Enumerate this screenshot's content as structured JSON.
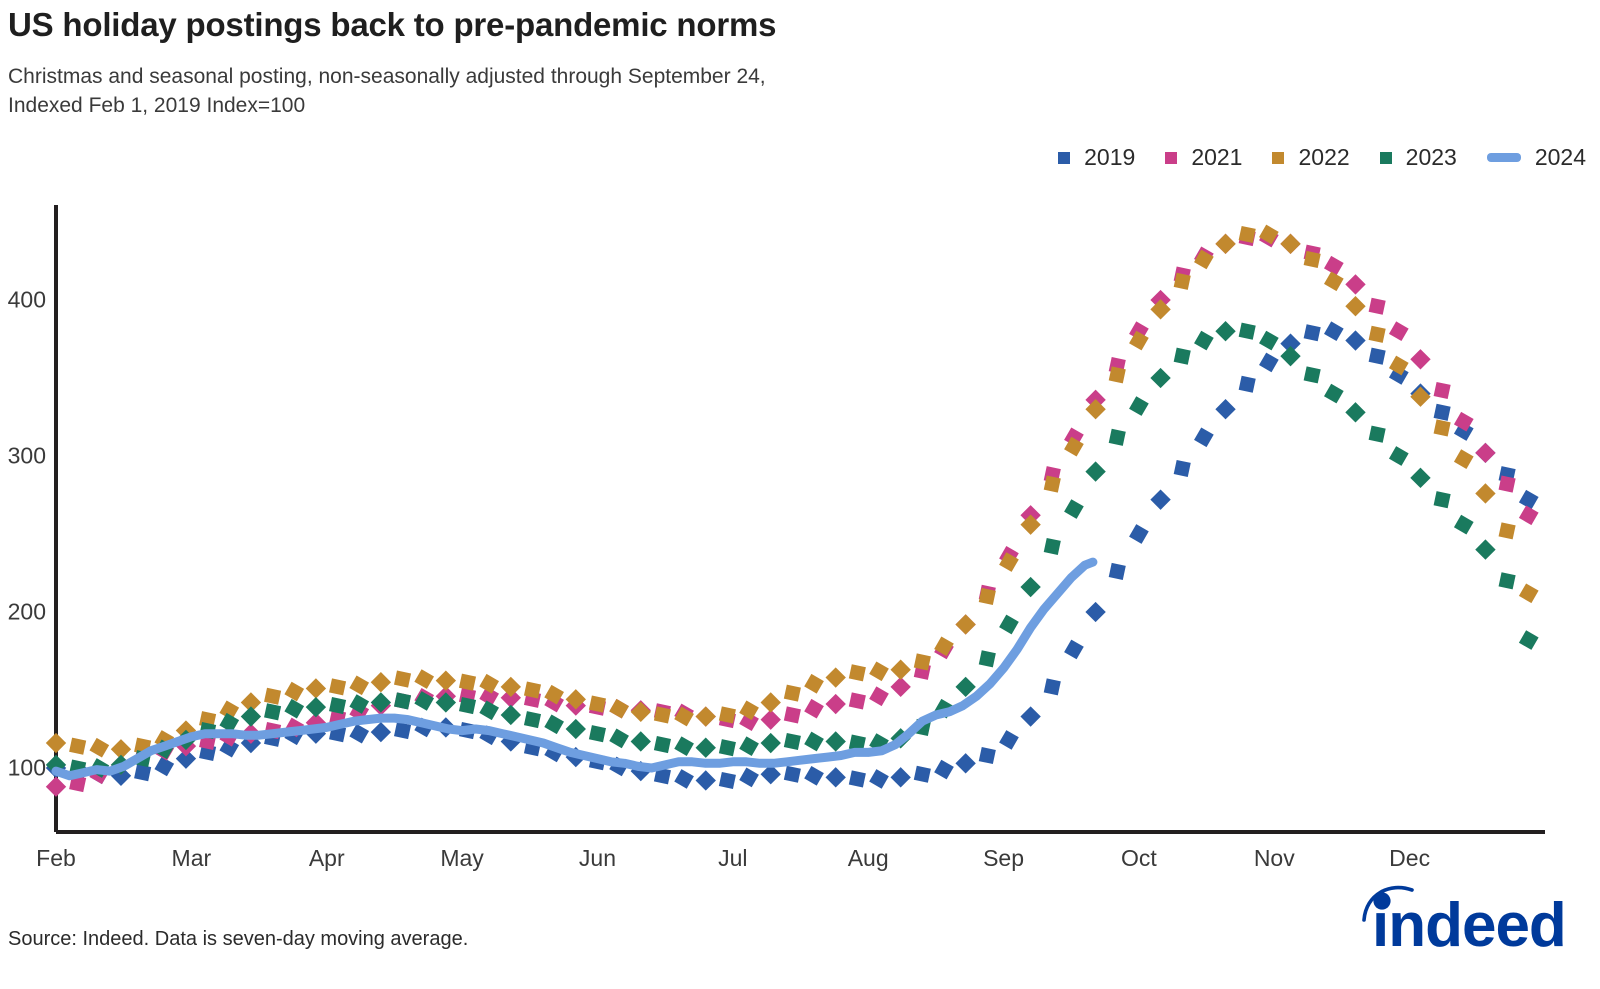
{
  "header": {
    "title": "US holiday postings back to pre-pandemic norms",
    "subtitle": "Christmas and seasonal posting, non-seasonally adjusted through September 24,\nIndexed Feb 1, 2019 Index=100"
  },
  "footer": {
    "source": "Source: Indeed. Data is seven-day moving average.",
    "logo_name": "indeed",
    "logo_color": "#003a9b"
  },
  "chart_data": {
    "type": "line",
    "title": "US holiday postings back to pre-pandemic norms",
    "subtitle": "Christmas and seasonal posting, non-seasonally adjusted through September 24, Indexed Feb 1, 2019 Index=100",
    "xlabel": "",
    "ylabel": "",
    "ylim": [
      75,
      455
    ],
    "xlim": [
      0,
      11
    ],
    "yticks": [
      100,
      200,
      300,
      400
    ],
    "ytick_labels": [
      "100",
      "200",
      "300",
      "400"
    ],
    "xticks": [
      0,
      1,
      2,
      3,
      4,
      5,
      6,
      7,
      8,
      9,
      10
    ],
    "xtick_labels": [
      "Feb",
      "Mar",
      "Apr",
      "May",
      "Jun",
      "Jul",
      "Aug",
      "Sep",
      "Oct",
      "Nov",
      "Dec"
    ],
    "grid": false,
    "legend_position": "top-right",
    "marker_style": "diamond",
    "series": [
      {
        "name": "2019",
        "color": "#2b5ca8",
        "style": "markers",
        "x": [
          0.0,
          0.16,
          0.32,
          0.48,
          0.64,
          0.8,
          0.96,
          1.12,
          1.28,
          1.44,
          1.6,
          1.76,
          1.92,
          2.08,
          2.24,
          2.4,
          2.56,
          2.72,
          2.88,
          3.04,
          3.2,
          3.36,
          3.52,
          3.68,
          3.84,
          4.0,
          4.16,
          4.32,
          4.48,
          4.64,
          4.8,
          4.96,
          5.12,
          5.28,
          5.44,
          5.6,
          5.76,
          5.92,
          6.08,
          6.24,
          6.4,
          6.56,
          6.72,
          6.88,
          7.04,
          7.2,
          7.36,
          7.52,
          7.68,
          7.84,
          8.0,
          8.16,
          8.32,
          8.48,
          8.64,
          8.8,
          8.96,
          9.12,
          9.28,
          9.44,
          9.6,
          9.76,
          9.92,
          10.08,
          10.24,
          10.4,
          10.56,
          10.72,
          10.88
        ],
        "y": [
          100,
          97,
          96,
          95,
          97,
          101,
          106,
          110,
          113,
          116,
          119,
          121,
          122,
          122,
          122,
          123,
          124,
          126,
          126,
          124,
          121,
          117,
          113,
          110,
          107,
          104,
          101,
          98,
          95,
          93,
          92,
          92,
          94,
          96,
          96,
          95,
          94,
          93,
          93,
          94,
          96,
          99,
          103,
          108,
          118,
          133,
          152,
          176,
          200,
          226,
          250,
          272,
          292,
          312,
          330,
          346,
          360,
          372,
          379,
          380,
          374,
          364,
          352,
          340,
          328,
          316,
          302,
          288,
          272
        ]
      },
      {
        "name": "2021",
        "color": "#ca3e89",
        "style": "markers",
        "x": [
          0.0,
          0.16,
          0.32,
          0.48,
          0.64,
          0.8,
          0.96,
          1.12,
          1.28,
          1.44,
          1.6,
          1.76,
          1.92,
          2.08,
          2.24,
          2.4,
          2.56,
          2.72,
          2.88,
          3.04,
          3.2,
          3.36,
          3.52,
          3.68,
          3.84,
          4.0,
          4.16,
          4.32,
          4.48,
          4.64,
          4.8,
          4.96,
          5.12,
          5.28,
          5.44,
          5.6,
          5.76,
          5.92,
          6.08,
          6.24,
          6.4,
          6.56,
          6.72,
          6.88,
          7.04,
          7.2,
          7.36,
          7.52,
          7.68,
          7.84,
          8.0,
          8.16,
          8.32,
          8.48,
          8.64,
          8.8,
          8.96,
          9.12,
          9.28,
          9.44,
          9.6,
          9.76,
          9.92,
          10.08,
          10.24,
          10.4,
          10.56,
          10.72,
          10.88
        ],
        "y": [
          88,
          90,
          96,
          102,
          107,
          111,
          114,
          117,
          120,
          122,
          124,
          126,
          129,
          132,
          136,
          140,
          143,
          145,
          146,
          146,
          146,
          145,
          144,
          142,
          140,
          139,
          138,
          137,
          136,
          135,
          133,
          131,
          130,
          131,
          134,
          138,
          141,
          143,
          146,
          152,
          162,
          176,
          192,
          212,
          236,
          262,
          288,
          312,
          336,
          358,
          380,
          400,
          416,
          428,
          436,
          440,
          440,
          436,
          430,
          422,
          410,
          396,
          380,
          362,
          342,
          322,
          302,
          282,
          262
        ]
      },
      {
        "name": "2022",
        "color": "#c2892e",
        "style": "markers",
        "x": [
          0.0,
          0.16,
          0.32,
          0.48,
          0.64,
          0.8,
          0.96,
          1.12,
          1.28,
          1.44,
          1.6,
          1.76,
          1.92,
          2.08,
          2.24,
          2.4,
          2.56,
          2.72,
          2.88,
          3.04,
          3.2,
          3.36,
          3.52,
          3.68,
          3.84,
          4.0,
          4.16,
          4.32,
          4.48,
          4.64,
          4.8,
          4.96,
          5.12,
          5.28,
          5.44,
          5.6,
          5.76,
          5.92,
          6.08,
          6.24,
          6.4,
          6.56,
          6.72,
          6.88,
          7.04,
          7.2,
          7.36,
          7.52,
          7.68,
          7.84,
          8.0,
          8.16,
          8.32,
          8.48,
          8.64,
          8.8,
          8.96,
          9.12,
          9.28,
          9.44,
          9.6,
          9.76,
          9.92,
          10.08,
          10.24,
          10.4,
          10.56,
          10.72,
          10.88
        ],
        "y": [
          116,
          114,
          113,
          112,
          114,
          118,
          124,
          131,
          137,
          142,
          146,
          149,
          151,
          152,
          153,
          155,
          157,
          157,
          156,
          155,
          154,
          152,
          150,
          147,
          144,
          141,
          138,
          136,
          134,
          133,
          133,
          134,
          137,
          142,
          148,
          154,
          158,
          161,
          162,
          163,
          168,
          178,
          192,
          210,
          232,
          256,
          282,
          306,
          330,
          352,
          374,
          394,
          412,
          426,
          436,
          442,
          442,
          436,
          426,
          412,
          396,
          378,
          358,
          338,
          318,
          298,
          276,
          252,
          212
        ]
      },
      {
        "name": "2023",
        "color": "#1a7a5e",
        "style": "markers",
        "x": [
          0.0,
          0.16,
          0.32,
          0.48,
          0.64,
          0.8,
          0.96,
          1.12,
          1.28,
          1.44,
          1.6,
          1.76,
          1.92,
          2.08,
          2.24,
          2.4,
          2.56,
          2.72,
          2.88,
          3.04,
          3.2,
          3.36,
          3.52,
          3.68,
          3.84,
          4.0,
          4.16,
          4.32,
          4.48,
          4.64,
          4.8,
          4.96,
          5.12,
          5.28,
          5.44,
          5.6,
          5.76,
          5.92,
          6.08,
          6.24,
          6.4,
          6.56,
          6.72,
          6.88,
          7.04,
          7.2,
          7.36,
          7.52,
          7.68,
          7.84,
          8.0,
          8.16,
          8.32,
          8.48,
          8.64,
          8.8,
          8.96,
          9.12,
          9.28,
          9.44,
          9.6,
          9.76,
          9.92,
          10.08,
          10.24,
          10.4,
          10.56,
          10.72,
          10.88
        ],
        "y": [
          102,
          100,
          100,
          102,
          106,
          112,
          118,
          124,
          129,
          133,
          136,
          138,
          139,
          140,
          141,
          142,
          143,
          143,
          142,
          140,
          137,
          134,
          131,
          128,
          125,
          122,
          119,
          117,
          115,
          114,
          113,
          113,
          114,
          116,
          117,
          117,
          117,
          116,
          116,
          119,
          126,
          138,
          152,
          170,
          192,
          216,
          242,
          266,
          290,
          312,
          332,
          350,
          364,
          374,
          380,
          380,
          374,
          364,
          352,
          340,
          328,
          314,
          300,
          286,
          272,
          256,
          240,
          220,
          182
        ]
      },
      {
        "name": "2024",
        "color": "#6e9ee0",
        "style": "line",
        "linewidth": 9,
        "x": [
          0.0,
          0.1,
          0.2,
          0.3,
          0.4,
          0.5,
          0.6,
          0.7,
          0.8,
          0.9,
          1.0,
          1.1,
          1.2,
          1.3,
          1.4,
          1.5,
          1.6,
          1.7,
          1.8,
          1.9,
          2.0,
          2.1,
          2.2,
          2.3,
          2.4,
          2.5,
          2.6,
          2.7,
          2.8,
          2.9,
          3.0,
          3.1,
          3.2,
          3.3,
          3.4,
          3.5,
          3.6,
          3.7,
          3.8,
          3.9,
          4.0,
          4.1,
          4.2,
          4.3,
          4.4,
          4.5,
          4.6,
          4.7,
          4.8,
          4.9,
          5.0,
          5.1,
          5.2,
          5.3,
          5.4,
          5.5,
          5.6,
          5.7,
          5.8,
          5.9,
          6.0,
          6.1,
          6.2,
          6.3,
          6.4,
          6.5,
          6.6,
          6.7,
          6.8,
          6.9,
          7.0,
          7.1,
          7.2,
          7.3,
          7.4,
          7.5,
          7.6,
          7.66
        ],
        "y": [
          98,
          95,
          97,
          99,
          98,
          101,
          106,
          111,
          114,
          117,
          120,
          122,
          122,
          122,
          121,
          121,
          122,
          123,
          124,
          125,
          126,
          128,
          130,
          131,
          132,
          132,
          131,
          129,
          127,
          125,
          124,
          125,
          124,
          122,
          120,
          118,
          116,
          113,
          110,
          108,
          106,
          104,
          103,
          101,
          100,
          102,
          104,
          104,
          103,
          103,
          104,
          104,
          103,
          103,
          104,
          105,
          106,
          107,
          108,
          110,
          110,
          111,
          115,
          122,
          130,
          134,
          136,
          140,
          146,
          154,
          164,
          176,
          190,
          202,
          212,
          222,
          230,
          232
        ]
      }
    ]
  },
  "legend": {
    "items": [
      {
        "label": "2019",
        "color": "#2b5ca8",
        "swatch": "square"
      },
      {
        "label": "2021",
        "color": "#ca3e89",
        "swatch": "square"
      },
      {
        "label": "2022",
        "color": "#c2892e",
        "swatch": "square"
      },
      {
        "label": "2023",
        "color": "#1a7a5e",
        "swatch": "square"
      },
      {
        "label": "2024",
        "color": "#6e9ee0",
        "swatch": "line"
      }
    ]
  },
  "axes": {
    "y_tick_labels": [
      "400",
      "300",
      "200",
      "100"
    ],
    "x_tick_labels": [
      "Feb",
      "Mar",
      "Apr",
      "May",
      "Jun",
      "Jul",
      "Aug",
      "Sep",
      "Oct",
      "Nov",
      "Dec"
    ],
    "axis_color": "#231f20"
  }
}
